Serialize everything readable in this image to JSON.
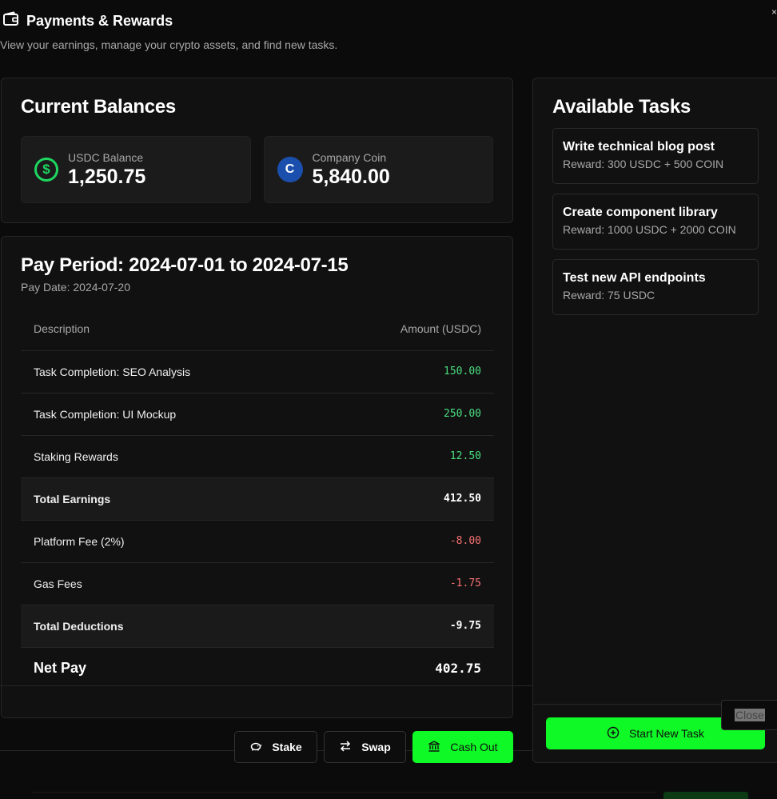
{
  "header": {
    "title": "Payments & Rewards",
    "subtitle": "View your earnings, manage your crypto assets, and find new tasks.",
    "close_x": "×"
  },
  "balances": {
    "title": "Current Balances",
    "usdc": {
      "label": "USDC Balance",
      "value": "1,250.75",
      "icon": "dollar-circle-icon",
      "icon_glyph": "$"
    },
    "coin": {
      "label": "Company Coin",
      "value": "5,840.00",
      "icon": "company-coin-icon",
      "icon_glyph": "C"
    }
  },
  "pay_period": {
    "title": "Pay Period: 2024-07-01 to 2024-07-15",
    "pay_date": "Pay Date: 2024-07-20",
    "col_description": "Description",
    "col_amount": "Amount (USDC)",
    "rows": [
      {
        "description": "Task Completion: SEO Analysis",
        "amount": "150.00"
      },
      {
        "description": "Task Completion: UI Mockup",
        "amount": "250.00"
      },
      {
        "description": "Staking Rewards",
        "amount": "12.50"
      },
      {
        "description": "Total Earnings",
        "amount": "412.50"
      },
      {
        "description": "Platform Fee (2%)",
        "amount": "-8.00"
      },
      {
        "description": "Gas Fees",
        "amount": "-1.75"
      },
      {
        "description": "Total Deductions",
        "amount": "-9.75"
      },
      {
        "description": "Net Pay",
        "amount": "402.75"
      }
    ]
  },
  "actions": {
    "stake": "Stake",
    "swap": "Swap",
    "cash_out": "Cash Out"
  },
  "tasks": {
    "title": "Available Tasks",
    "items": [
      {
        "name": "Write technical blog post",
        "reward": "Reward: 300 USDC + 500 COIN"
      },
      {
        "name": "Create component library",
        "reward": "Reward: 1000 USDC + 2000 COIN"
      },
      {
        "name": "Test new API endpoints",
        "reward": "Reward: 75 USDC"
      }
    ],
    "start_new": "Start New Task"
  },
  "close_label": "Close",
  "colors": {
    "accent_green": "#0ef925",
    "positive": "#4ade80",
    "negative": "#f87171",
    "coin_blue": "#1b4fae"
  }
}
